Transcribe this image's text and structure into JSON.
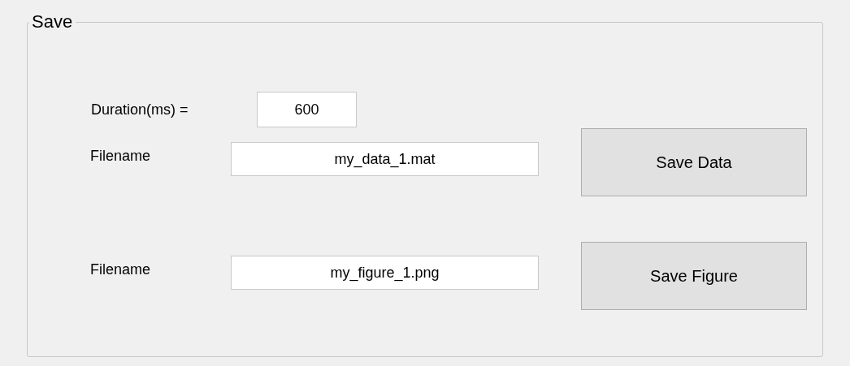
{
  "group": {
    "title": "Save"
  },
  "duration": {
    "label": "Duration(ms) =",
    "value": "600"
  },
  "rows": [
    {
      "label": "Filename",
      "value": "my_data_1.mat",
      "button": "Save Data"
    },
    {
      "label": "Filename",
      "value": "my_figure_1.png",
      "button": "Save Figure"
    }
  ]
}
